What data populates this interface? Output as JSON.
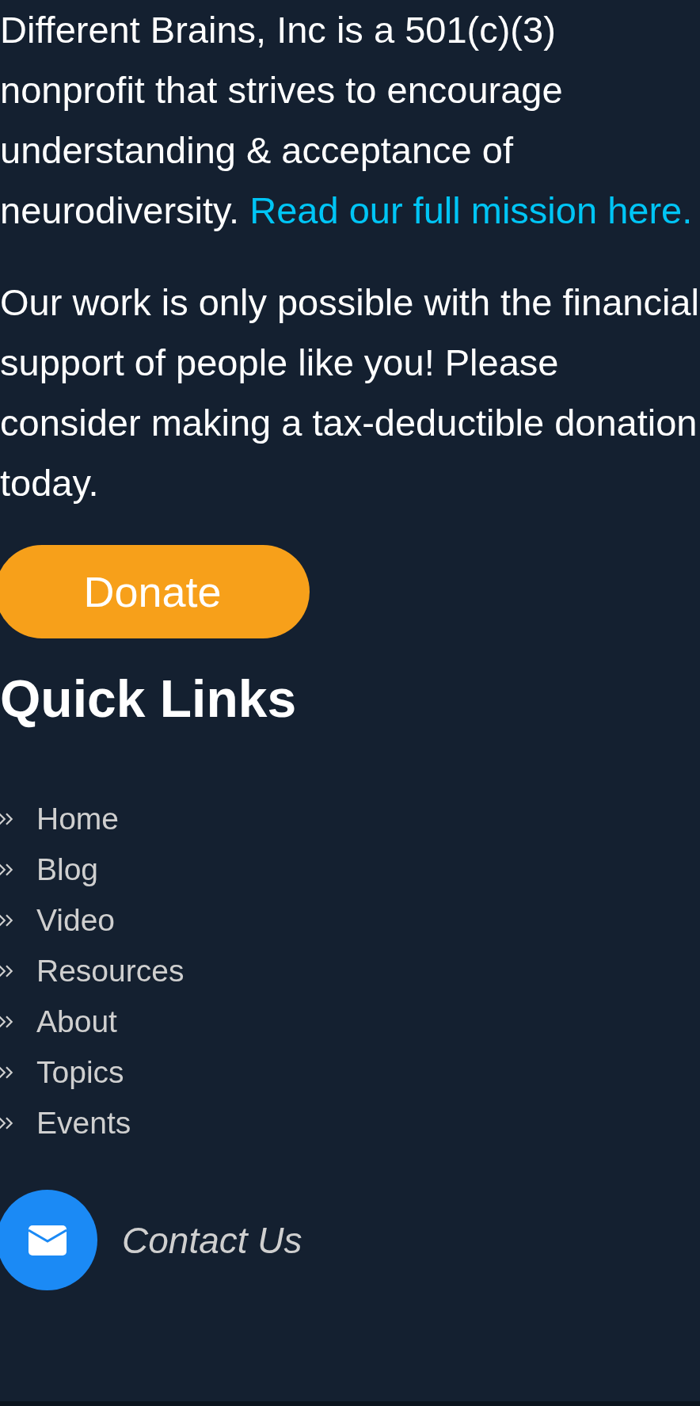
{
  "mission": {
    "text": "Different Brains, Inc is a 501(c)(3) nonprofit that strives to encourage understanding & acceptance of neurodiversity.",
    "link": "Read our full mission here."
  },
  "appeal": "Our work is only possible with the financial support of people like you! Please consider making a tax-deductible donation today.",
  "donate_button": "Donate",
  "quick_links": {
    "title": "Quick Links",
    "items": [
      "Home",
      "Blog",
      "Video",
      "Resources",
      "About",
      "Topics",
      "Events"
    ]
  },
  "contact": {
    "label": "Contact Us"
  }
}
